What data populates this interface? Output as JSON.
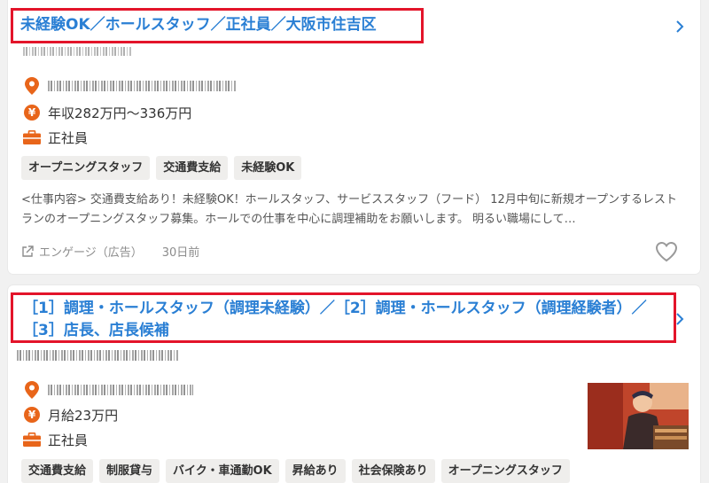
{
  "cards": [
    {
      "title": "未経験OK／ホールスタッフ／正社員／大阪市住吉区",
      "salary": "年収282万円～336万円",
      "employment": "正社員",
      "tags": [
        "オープニングスタッフ",
        "交通費支給",
        "未経験OK"
      ],
      "description": "<仕事内容> 交通費支給あり！未経験OK！ホールスタッフ、サービススタッフ（フード） 12月中旬に新規オープンするレストランのオープニングスタッフ募集。ホールでの仕事を中心に調理補助をお願いします。 明るい職場にして…",
      "source": "エンゲージ（広告）",
      "posted": "30日前"
    },
    {
      "title": "［1］調理・ホールスタッフ（調理未経験）／［2］調理・ホールスタッフ（調理経験者）／［3］店長、店長候補",
      "salary": "月給23万円",
      "employment": "正社員",
      "tags": [
        "交通費支給",
        "制服貸与",
        "バイク・車通勤OK",
        "昇給あり",
        "社会保険あり",
        "オープニングスタッフ"
      ]
    }
  ],
  "icons": {
    "location": "location-pin-icon",
    "salary": "yen-icon",
    "employment": "briefcase-icon",
    "chevron": "chevron-right-icon",
    "favorite": "heart-icon",
    "external": "external-link-icon"
  },
  "colors": {
    "title": "#2a7fd4",
    "highlight_border": "#e3142a",
    "icon_accent": "#e8651a",
    "tag_bg": "#efeeec",
    "background": "#f1f1f1"
  }
}
